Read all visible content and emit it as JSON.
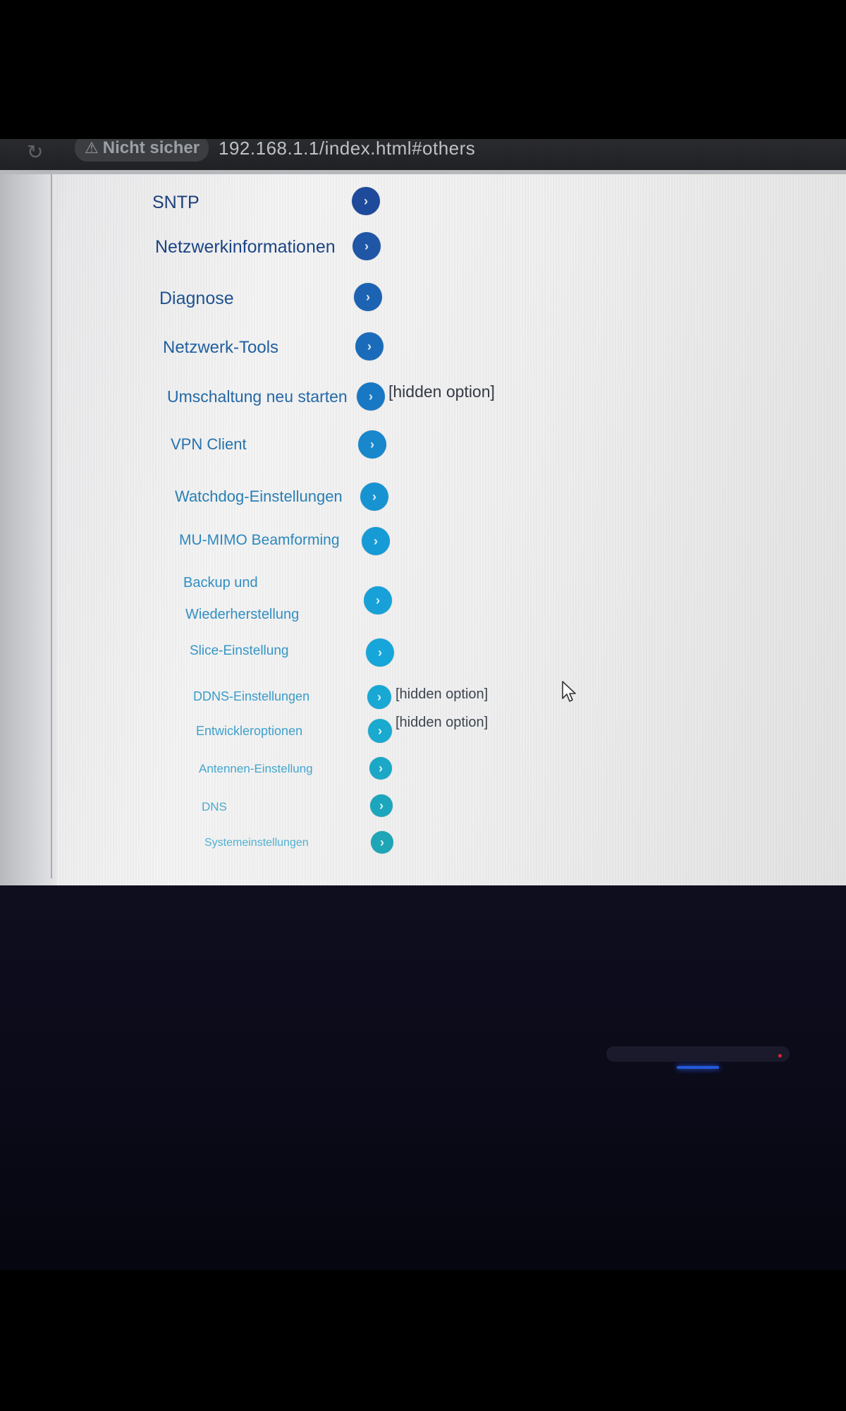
{
  "browser": {
    "security_label": "Nicht sicher",
    "url": "192.168.1.1/index.html#others"
  },
  "menu": {
    "hidden_tag": "[hidden option]",
    "items": [
      {
        "label": "SNTP"
      },
      {
        "label": "Netzwerkinformationen"
      },
      {
        "label": "Diagnose"
      },
      {
        "label": "Netzwerk-Tools"
      },
      {
        "label": "Umschaltung neu starten"
      },
      {
        "label": "VPN Client"
      },
      {
        "label": "Watchdog-Einstellungen"
      },
      {
        "label": "MU-MIMO Beamforming"
      },
      {
        "label_line1": "Backup und",
        "label_line2": "Wiederherstellung"
      },
      {
        "label": "Slice-Einstellung"
      },
      {
        "label": "DDNS-Einstellungen"
      },
      {
        "label": "Entwickleroptionen"
      },
      {
        "label": "Antennen-Einstellung"
      },
      {
        "label": "DNS"
      },
      {
        "label": "Systemeinstellungen"
      }
    ]
  },
  "colors": {
    "button_dark": "#1d4f9e",
    "button_mid": "#1478c8",
    "button_light": "#17a5d6",
    "label_dark": "#1c3f7a",
    "label_light": "#3aa8cc"
  },
  "icons": {
    "arrow": "chevron-right-icon",
    "reload": "reload-icon",
    "warning": "warning-icon",
    "cursor": "mouse-cursor-icon"
  }
}
